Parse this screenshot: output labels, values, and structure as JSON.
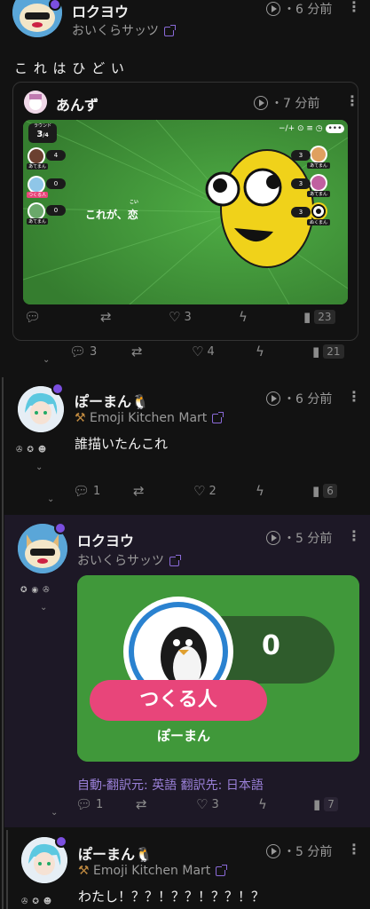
{
  "posts": [
    {
      "name": "ロクヨウ",
      "handle": "おいくらサッツ",
      "time": "・6 分前",
      "text": "こ れ は ひ ど い",
      "quote": {
        "name": "あんず",
        "time": "・7 分前",
        "image": {
          "round_label": "ラウンド",
          "round_value": "3",
          "round_total": "/4",
          "caption": "これが、恋",
          "ruby": "こい",
          "left_labels": [
            "あてまん",
            "つくる人",
            "あてまん"
          ],
          "left_scores": [
            "4",
            "0",
            "0"
          ],
          "right_labels": [
            "あてまん",
            "あてまん",
            "ぬくまん"
          ],
          "right_scores": [
            "3",
            "3",
            "3"
          ]
        },
        "actions": {
          "reply": "",
          "renote": "",
          "like": "3",
          "zap": "",
          "stats": "23"
        }
      },
      "actions": {
        "reply": "3",
        "renote": "",
        "like": "4",
        "zap": "",
        "stats": "21"
      }
    },
    {
      "name": "ぽーまん🐧",
      "handle": "Emoji Kitchen Mart",
      "time": "・6 分前",
      "text": "誰描いたんこれ",
      "actions": {
        "reply": "1",
        "renote": "",
        "like": "2",
        "zap": "",
        "stats": "6"
      }
    },
    {
      "name": "ロクヨウ",
      "handle": "おいくらサッツ",
      "time": "・5 分前",
      "image": {
        "score": "0",
        "role": "つくる人",
        "player": "ぽーまん"
      },
      "translation": {
        "prefix": "自動-翻訳元: ",
        "from": "英語",
        "mid": " 翻訳先: ",
        "to": "日本語"
      },
      "actions": {
        "reply": "1",
        "renote": "",
        "like": "3",
        "zap": "",
        "stats": "7"
      }
    },
    {
      "name": "ぽーまん🐧",
      "handle": "Emoji Kitchen Mart",
      "time": "・5 分前",
      "text": "わたし！？？！？？！？？！？"
    }
  ],
  "colors": {
    "accent": "#7b4fe0",
    "green": "#3f9a3a",
    "pink": "#e8457a",
    "bg": "#121212",
    "highlight_bg": "#1d1826"
  }
}
